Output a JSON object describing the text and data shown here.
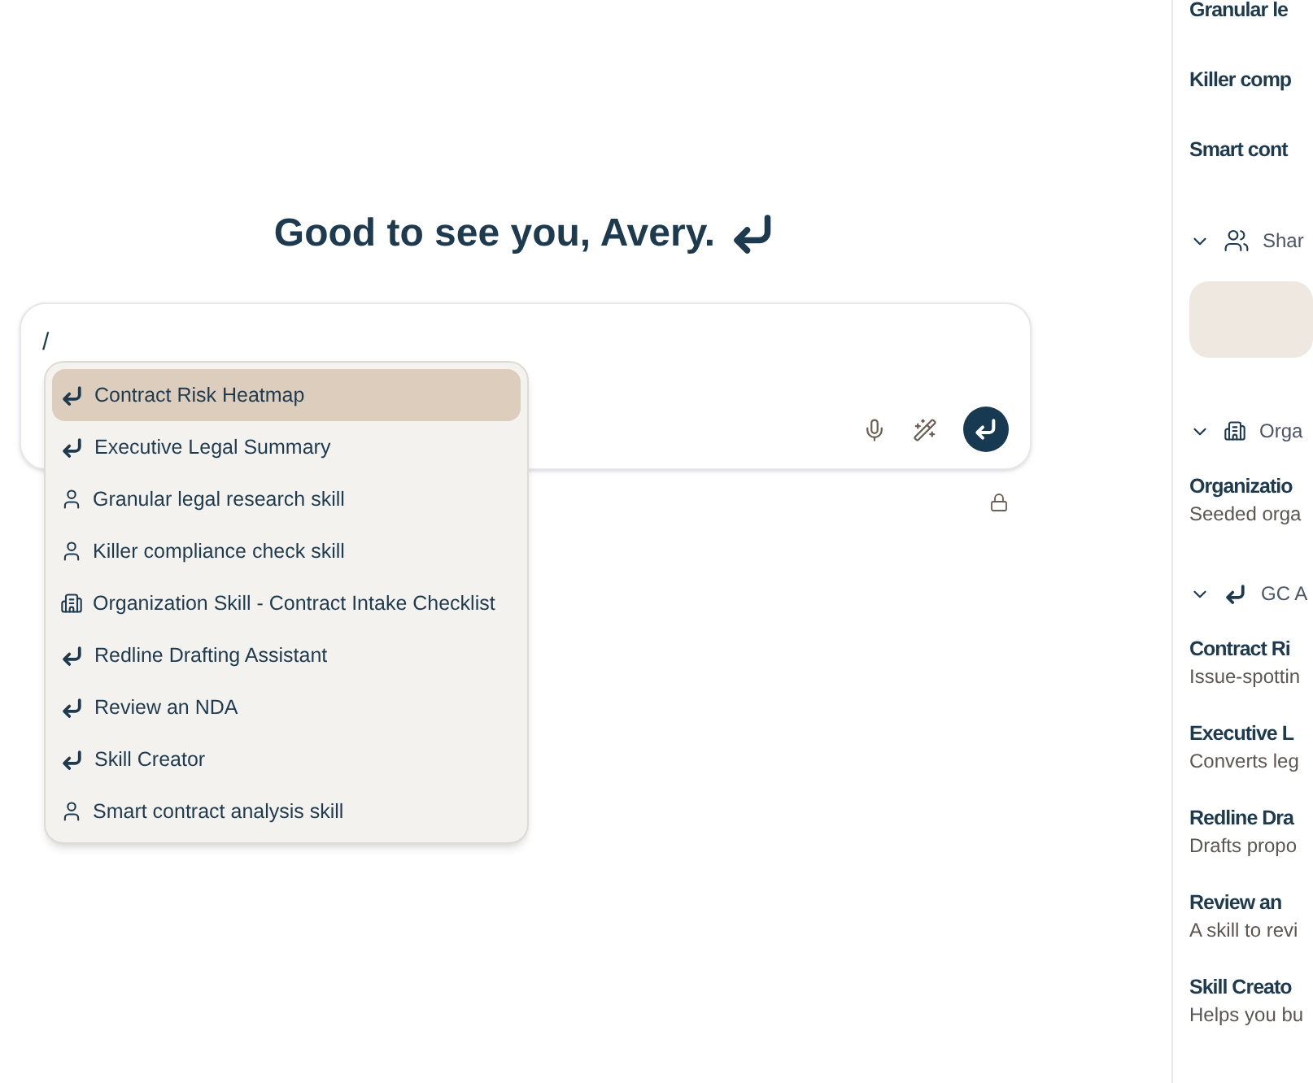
{
  "greeting": "Good to see you, Avery.",
  "composer": {
    "value": "/"
  },
  "menu": [
    {
      "label": "Contract Risk Heatmap",
      "kind": "skill",
      "selected": true
    },
    {
      "label": "Executive Legal Summary",
      "kind": "skill",
      "selected": false
    },
    {
      "label": "Granular legal research skill",
      "kind": "personal",
      "selected": false
    },
    {
      "label": "Killer compliance check skill",
      "kind": "personal",
      "selected": false
    },
    {
      "label": "Organization Skill - Contract Intake Checklist",
      "kind": "organization",
      "selected": false
    },
    {
      "label": "Redline Drafting Assistant",
      "kind": "skill",
      "selected": false
    },
    {
      "label": "Review an NDA",
      "kind": "skill",
      "selected": false
    },
    {
      "label": "Skill Creator",
      "kind": "skill",
      "selected": false
    },
    {
      "label": "Smart contract analysis skill",
      "kind": "personal",
      "selected": false
    }
  ],
  "sidebar": {
    "top_items": [
      "Granular le",
      "Killer comp",
      "Smart cont"
    ],
    "sections": [
      {
        "title": "Shar",
        "kind": "shared",
        "expanded": true
      },
      {
        "title": "Orga",
        "kind": "organization",
        "expanded": true,
        "items": [
          {
            "title": "Organizatio",
            "description": "Seeded orga"
          }
        ]
      },
      {
        "title": "GC A",
        "kind": "skill",
        "expanded": true,
        "items": [
          {
            "title": "Contract Ri",
            "description": "Issue-spottin"
          },
          {
            "title": "Executive L",
            "description": "Converts leg"
          },
          {
            "title": "Redline Dra",
            "description": "Drafts propo"
          },
          {
            "title": "Review an",
            "description": "A skill to revi"
          },
          {
            "title": "Skill Creato",
            "description": "Helps you bu"
          }
        ]
      }
    ]
  }
}
